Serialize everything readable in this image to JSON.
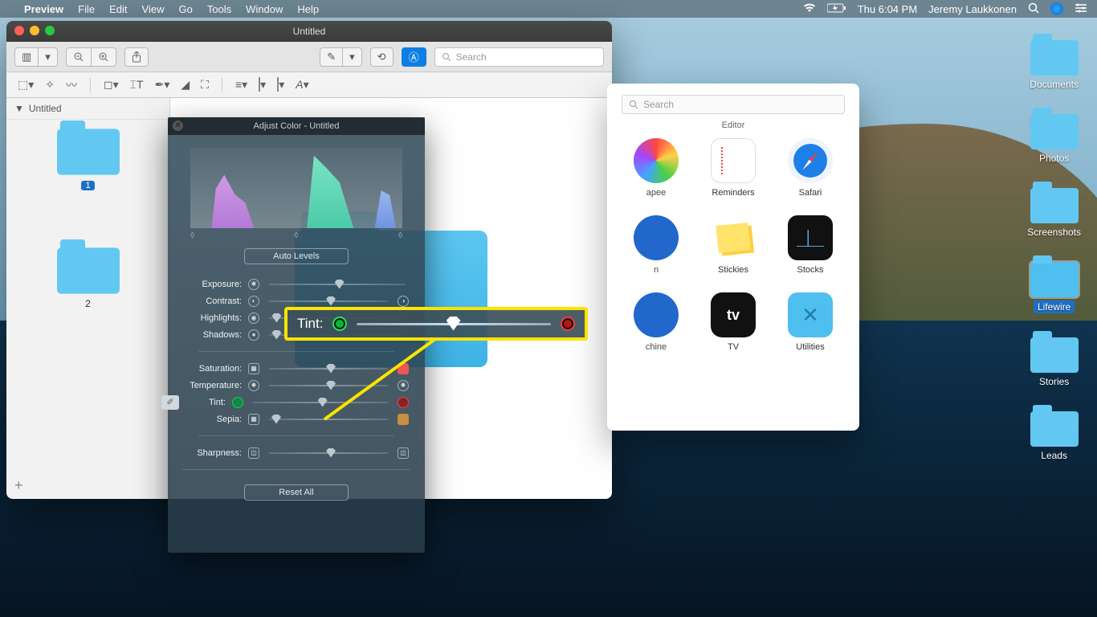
{
  "menubar": {
    "app": "Preview",
    "items": [
      "File",
      "Edit",
      "View",
      "Go",
      "Tools",
      "Window",
      "Help"
    ],
    "clock": "Thu 6:04 PM",
    "user": "Jeremy Laukkonen"
  },
  "desktop_folders": [
    {
      "name": "Documents",
      "selected": false
    },
    {
      "name": "Photos",
      "selected": false
    },
    {
      "name": "Screenshots",
      "selected": false
    },
    {
      "name": "Lifewire",
      "selected": true
    },
    {
      "name": "Stories",
      "selected": false
    },
    {
      "name": "Leads",
      "selected": false
    }
  ],
  "preview_window": {
    "title": "Untitled",
    "search_placeholder": "Search",
    "sidebar_title": "Untitled",
    "thumbs": [
      {
        "page": "1",
        "badge": "1"
      },
      {
        "page": "2"
      }
    ]
  },
  "adjust_panel": {
    "title": "Adjust Color - Untitled",
    "auto_levels": "Auto Levels",
    "controls": {
      "exposure": "Exposure:",
      "contrast": "Contrast:",
      "highlights": "Highlights:",
      "shadows": "Shadows:",
      "saturation": "Saturation:",
      "temperature": "Temperature:",
      "tint": "Tint:",
      "sepia": "Sepia:",
      "sharpness": "Sharpness:"
    },
    "reset_all": "Reset All"
  },
  "callout": {
    "label": "Tint:"
  },
  "picker": {
    "search_placeholder": "Search",
    "heading": "Editor",
    "apps": [
      {
        "name": "apee",
        "class": "ic-color",
        "cut": true
      },
      {
        "name": "Reminders",
        "class": "ic-rem"
      },
      {
        "name": "Safari",
        "class": "ic-saf"
      },
      {
        "name": "n",
        "class": "ic-bl",
        "cut": true
      },
      {
        "name": "Stickies",
        "class": "ic-sti"
      },
      {
        "name": "Stocks",
        "class": "ic-stk"
      },
      {
        "name": "chine",
        "class": "ic-bl",
        "cut": true
      },
      {
        "name": "TV",
        "class": "ic-tv"
      },
      {
        "name": "Utilities",
        "class": "ic-ut"
      }
    ]
  }
}
